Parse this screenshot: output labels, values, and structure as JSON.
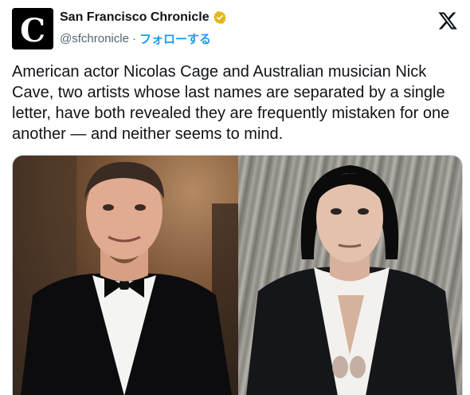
{
  "account": {
    "display_name": "San Francisco Chronicle",
    "handle": "@sfchronicle",
    "separator": "·",
    "follow_label": "フォローする",
    "avatar_letter": "C",
    "verified_icon": "verified-gold-badge-icon",
    "platform_icon": "x-logo-icon"
  },
  "tweet": {
    "text": "American actor Nicolas Cage and Australian musician Nick Cave, two artists whose last names are separated by a single letter, have both revealed they are frequently mistaken for one another — and neither seems to mind."
  },
  "media": {
    "images": [
      {
        "description_icon": "photo-nicolas-cage"
      },
      {
        "description_icon": "photo-nick-cave"
      }
    ]
  },
  "colors": {
    "link": "#1d9bf0",
    "muted": "#536471",
    "text": "#0f1419",
    "verified": "#e2b719"
  }
}
